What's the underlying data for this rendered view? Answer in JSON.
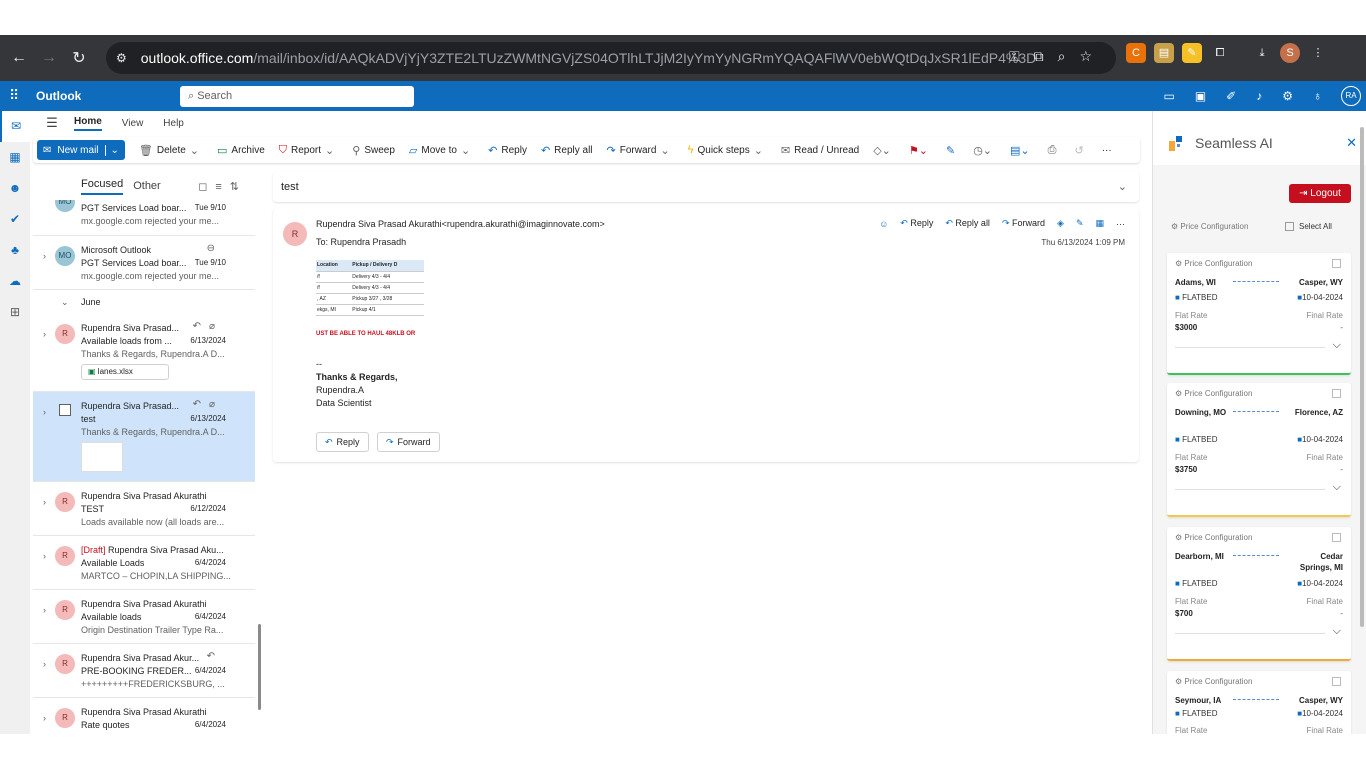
{
  "browser": {
    "url_host": "outlook.office.com",
    "url_path": "/mail/inbox/id/AAQkADVjYjY3ZTE2LTUzZWMtNGVjZS04OTlhLTJjM2IyYmYyNGRmYQAQAFlWV0ebWQtDqJxSR1lEdP4%3D",
    "profile_initial": "S"
  },
  "outlook": {
    "brand": "Outlook",
    "search_placeholder": "Search",
    "account_initials": "RA"
  },
  "ribbon_tabs": [
    "Home",
    "View",
    "Help"
  ],
  "ribbon": {
    "new_mail": "New mail",
    "delete": "Delete",
    "archive": "Archive",
    "report": "Report",
    "sweep": "Sweep",
    "move_to": "Move to",
    "reply": "Reply",
    "reply_all": "Reply all",
    "forward": "Forward",
    "quick_steps": "Quick steps",
    "read_unread": "Read / Unread",
    "more": "···"
  },
  "folder_tabs": {
    "focused": "Focused",
    "other": "Other"
  },
  "group_june": "June",
  "messages": [
    {
      "from": "",
      "subject": "PGT Services Load boar...",
      "date": "Tue 9/10",
      "preview": "mx.google.com rejected your me..."
    },
    {
      "from": "Microsoft Outlook",
      "subject": "PGT Services Load boar...",
      "date": "Tue 9/10",
      "preview": "mx.google.com rejected your me...",
      "initials": "MO"
    },
    {
      "from": "Rupendra Siva Prasad...",
      "subject": "Available loads from ...",
      "date": "6/13/2024",
      "preview": "Thanks & Regards, Rupendra.A D...",
      "attachment": "lanes.xlsx",
      "initials": "R"
    },
    {
      "from": "Rupendra Siva Prasad...",
      "subject": "test",
      "date": "6/13/2024",
      "preview": "Thanks & Regards, Rupendra.A D..."
    },
    {
      "from": "Rupendra Siva Prasad Akurathi",
      "subject": "TEST",
      "date": "6/12/2024",
      "preview": "Loads available now (all loads are...",
      "initials": "R"
    },
    {
      "draft": "[Draft]",
      "from": "Rupendra Siva Prasad Aku...",
      "subject": "Available Loads",
      "date": "6/4/2024",
      "preview": "MARTCO – CHOPIN,LA SHIPPING...",
      "initials": "R"
    },
    {
      "from": "Rupendra Siva Prasad Akurathi",
      "subject": "Available loads",
      "date": "6/4/2024",
      "preview": "Origin Destination Trailer Type Ra...",
      "initials": "R"
    },
    {
      "from": "Rupendra Siva Prasad Akur...",
      "subject": "PRE-BOOKING FREDER...",
      "date": "6/4/2024",
      "preview": "+++++++++FREDERICKSBURG, ...",
      "initials": "R"
    },
    {
      "from": "Rupendra Siva Prasad Akurathi",
      "subject": "Rate quotes",
      "date": "6/4/2024",
      "preview": "",
      "initials": "R"
    }
  ],
  "reading": {
    "subject": "test",
    "avatar": "R",
    "from": "Rupendra Siva Prasad Akurathi<rupendra.akurathi@imaginnovate.com>",
    "to_label": "To:",
    "to": "Rupendra Prasadh",
    "date": "Thu 6/13/2024 1:09 PM",
    "reply": "Reply",
    "reply_all": "Reply all",
    "forward": "Forward",
    "table_headers": [
      "Location",
      "Pickup / Delivery D"
    ],
    "table_rows": [
      [
        "/f",
        "Delivery 4/3 - 4/4"
      ],
      [
        "/f",
        "Delivery 4/3 - 4/4"
      ],
      [
        ", AZ",
        "Pickup 3/27 , 3/28"
      ],
      [
        "ekgs, MI",
        "Pickup 4/1"
      ]
    ],
    "notice": "UST BE ABLE TO HAUL 48KLB OR",
    "sig_dashes": "--",
    "sig_regards": "Thanks & Regards,",
    "sig_name": "Rupendra.A",
    "sig_title": "Data Scientist"
  },
  "panel": {
    "title": "Seamless AI",
    "logout": "Logout",
    "price_config": "Price Configuration",
    "select_all": "Select All",
    "flat_rate": "Flat Rate",
    "final_rate": "Final Rate",
    "cards": [
      {
        "origin": "Adams, WI",
        "dest": "Casper, WY",
        "equip": "FLATBED",
        "date": "10-04-2024",
        "flat": "$3000",
        "final": "-",
        "accent": "#3ec35a"
      },
      {
        "origin": "Downing, MO",
        "dest": "Florence, AZ",
        "equip": "FLATBED",
        "date": "10-04-2024",
        "flat": "$3750",
        "final": "-",
        "accent": "#f2c94c"
      },
      {
        "origin": "Dearborn, MI",
        "dest": "Cedar Springs, MI",
        "equip": "FLATBED",
        "date": "10-04-2024",
        "flat": "$700",
        "final": "-",
        "accent": "#f2a93b"
      },
      {
        "origin": "Seymour, IA",
        "dest": "Casper, WY",
        "equip": "FLATBED",
        "date": "10-04-2024",
        "flat": "",
        "final": "",
        "accent": "#ffffff"
      }
    ]
  }
}
